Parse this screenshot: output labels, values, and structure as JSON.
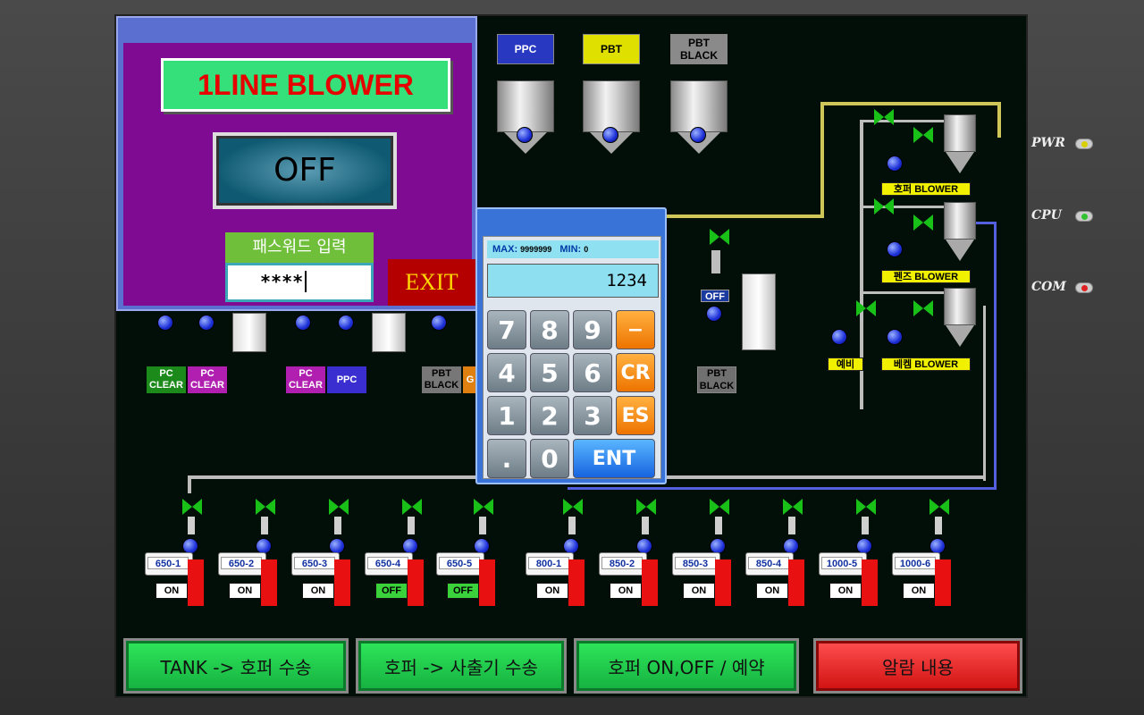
{
  "indicators": [
    {
      "label": "PWR",
      "color": "#d8d000"
    },
    {
      "label": "CPU",
      "color": "#30c030"
    },
    {
      "label": "COM",
      "color": "#e02020"
    }
  ],
  "silos": [
    {
      "label": "PPC",
      "color": "#2838c0",
      "text_color": "#ffffff"
    },
    {
      "label": "PBT",
      "color": "#e0e000",
      "text_color": "#000000"
    },
    {
      "label": "PBT BLACK",
      "color": "#8a8a8a",
      "text_color": "#000000"
    }
  ],
  "blowers": [
    {
      "label": "호퍼 BLOWER"
    },
    {
      "label": "펜즈 BLOWER"
    },
    {
      "label": "예비"
    },
    {
      "label": "베켐 BLOWER"
    }
  ],
  "mid_tags": [
    {
      "label": "PC CLEAR"
    },
    {
      "label": "PC CLEAR"
    },
    {
      "label": "PC CLEAR"
    },
    {
      "label": "PPC"
    },
    {
      "label": "PBT BLACK"
    },
    {
      "label": "G"
    }
  ],
  "mid_right": {
    "status": "OFF",
    "label": "PBT BLACK"
  },
  "machines": [
    {
      "label": "650-1",
      "status": "ON"
    },
    {
      "label": "650-2",
      "status": "ON"
    },
    {
      "label": "650-3",
      "status": "ON"
    },
    {
      "label": "650-4",
      "status": "OFF"
    },
    {
      "label": "650-5",
      "status": "OFF"
    },
    {
      "label": "800-1",
      "status": "ON"
    },
    {
      "label": "850-2",
      "status": "ON"
    },
    {
      "label": "850-3",
      "status": "ON"
    },
    {
      "label": "850-4",
      "status": "ON"
    },
    {
      "label": "1000-5",
      "status": "ON"
    },
    {
      "label": "1000-6",
      "status": "ON"
    }
  ],
  "nav": [
    {
      "label": "TANK -> 호퍼 수송"
    },
    {
      "label": "호퍼 -> 사출기 수송"
    },
    {
      "label": "호퍼 ON,OFF / 예약"
    },
    {
      "label": "알람 내용"
    }
  ],
  "popup": {
    "title": "1LINE BLOWER",
    "state": "OFF",
    "password_label": "패스워드 입력",
    "password_value": "****",
    "exit": "EXIT"
  },
  "keypad": {
    "max_label": "MAX:",
    "max_value": "9999999",
    "min_label": "MIN:",
    "min_value": "0",
    "display": "1234",
    "keys": [
      "7",
      "8",
      "9",
      "−",
      "4",
      "5",
      "6",
      "CR",
      "1",
      "2",
      "3",
      "ES",
      ".",
      "0",
      "ENT"
    ]
  }
}
